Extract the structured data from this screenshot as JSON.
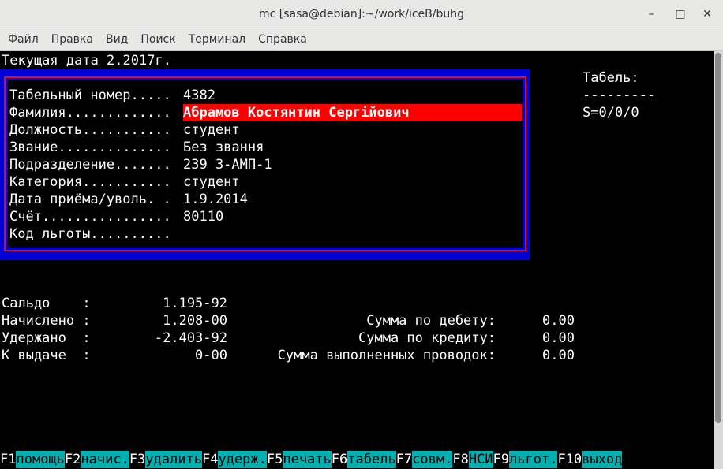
{
  "window": {
    "title": "mc [sasa@debian]:~/work/iceB/buhg",
    "minimize_glyph": "–",
    "maximize_glyph": "□",
    "close_glyph": "✕"
  },
  "menu": [
    "Файл",
    "Правка",
    "Вид",
    "Поиск",
    "Терминал",
    "Справка"
  ],
  "terminal": {
    "current_date_line": "Текущая дата 2.2017г.",
    "employee": {
      "tab_number_label": "Табельный номер.....",
      "tab_number_value": "4382",
      "surname_label": "Фамилия.............",
      "surname_value": "Абрамов Костянтин Сергійович",
      "position_label": "Должность...........",
      "position_value": "студент",
      "rank_label": "Звание..............",
      "rank_value": "Без звання",
      "department_label": "Подразделение.......",
      "department_value": "239 З-АМП-1",
      "category_label": "Категория...........",
      "category_value": "студент",
      "hire_date_label": "Дата приёма/уволь. .",
      "hire_date_value": "1.9.2014",
      "account_label": "Счёт................",
      "account_value": "80110",
      "benefit_code_label": "Код льготы.........."
    },
    "tabel": {
      "title": "Табель:",
      "separator": "---------",
      "summary": "S=0/0/0"
    },
    "totals": {
      "saldo_label": "Сальдо    :",
      "saldo_value": "1.195-92",
      "accrued_label": "Начислено :",
      "accrued_value": "1.208-00",
      "withheld_label": "Удержано  :",
      "withheld_value": "-2.403-92",
      "payout_label": "К выдаче  :",
      "payout_value": "0-00",
      "debit_label": "Сумма по дебету:",
      "debit_value": "0.00",
      "credit_label": "Сумма по кредиту:",
      "credit_value": "0.00",
      "entries_label": "Сумма выполненных проводок:",
      "entries_value": "0.00"
    },
    "fkeys": [
      {
        "key": "F1",
        "label": "помощь"
      },
      {
        "key": "F2",
        "label": "начис."
      },
      {
        "key": "F3",
        "label": "удалить"
      },
      {
        "key": "F4",
        "label": "удерж."
      },
      {
        "key": "F5",
        "label": "печать"
      },
      {
        "key": "F6",
        "label": "табель"
      },
      {
        "key": "F7",
        "label": "совм."
      },
      {
        "key": "F8",
        "label": "НСИ"
      },
      {
        "key": "F9",
        "label": "льгот."
      },
      {
        "key": "F10",
        "label": "выход"
      }
    ]
  }
}
